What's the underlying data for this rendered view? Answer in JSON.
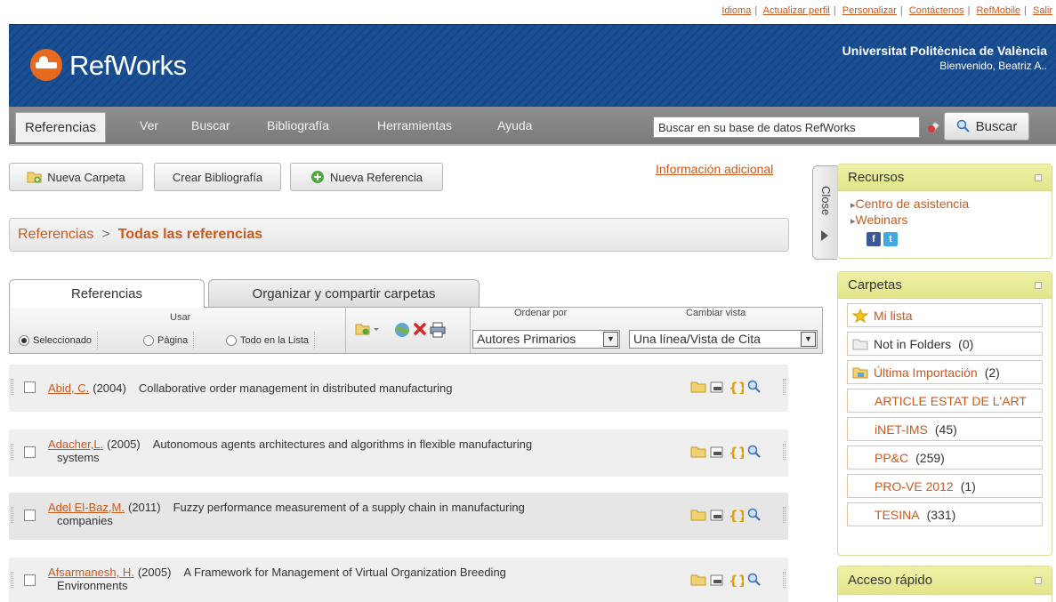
{
  "top_links": [
    "Idioma",
    "Actualizar perfil",
    "Personalizar",
    "Contáctenos",
    "RefMobile",
    "Salir"
  ],
  "header": {
    "logo_text": "RefWorks",
    "institution": "Universitat Politècnica de València",
    "welcome": "Bienvenido, Beatriz A.."
  },
  "nav": {
    "tabs": [
      "Referencias",
      "Ver",
      "Buscar",
      "Bibliografía",
      "Herramientas",
      "Ayuda"
    ],
    "search_value": "Buscar en su base de datos RefWorks",
    "search_button": "Buscar"
  },
  "actions": {
    "new_folder": "Nueva Carpeta",
    "create_bib": "Crear Bibliografía",
    "new_ref": "Nueva Referencia",
    "info_link": "Información adicional"
  },
  "breadcrumb": {
    "root": "Referencias",
    "separator": ">",
    "current": "Todas las referencias"
  },
  "panel_tabs": [
    "Referencias",
    "Organizar y compartir carpetas"
  ],
  "toolbar": {
    "usar_label": "Usar",
    "radios": [
      {
        "label": "Seleccionado",
        "checked": true
      },
      {
        "label": "Página",
        "checked": false
      },
      {
        "label": "Todo en la Lista",
        "checked": false
      }
    ],
    "sort_label": "Ordenar por",
    "sort_value": "Autores Primarios",
    "view_label": "Cambiar vista",
    "view_value": "Una línea/Vista de Cita"
  },
  "references": [
    {
      "author": "Abid, C.",
      "year": "(2004)",
      "title": "Collaborative order management in distributed manufacturing",
      "title2": ""
    },
    {
      "author": "Adacher,L.",
      "year": "(2005)",
      "title": "Autonomous agents architectures and algorithms in flexible manufacturing",
      "title2": "systems"
    },
    {
      "author": "Adel El-Baz,M.",
      "year": "(2011)",
      "title": "Fuzzy performance measurement of a supply chain in manufacturing",
      "title2": "companies"
    },
    {
      "author": "Afsarmanesh, H.",
      "year": "(2005)",
      "title": "A Framework for Management of Virtual Organization Breeding",
      "title2": "Environments"
    }
  ],
  "close_label": "Close",
  "sidebar": {
    "recursos": {
      "title": "Recursos",
      "links": [
        "Centro de asistencia",
        "Webinars"
      ]
    },
    "carpetas": {
      "title": "Carpetas",
      "items": [
        {
          "label": "Mi lista",
          "count": ""
        },
        {
          "label": "Not in Folders",
          "count": "(0)"
        },
        {
          "label": "Última Importación",
          "count": "(2)"
        },
        {
          "label": "ARTICLE ESTAT DE L'ART",
          "count": ""
        },
        {
          "label": "iNET-IMS",
          "count": "(45)"
        },
        {
          "label": "PP&C",
          "count": "(259)"
        },
        {
          "label": "PRO-VE 2012",
          "count": "(1)"
        },
        {
          "label": "TESINA",
          "count": "(331)"
        }
      ]
    },
    "acceso": {
      "title": "Acceso rápido"
    }
  },
  "colors": {
    "accent": "#c9591c",
    "header_blue": "#1b4f94",
    "panel_green": "#e5e98f"
  }
}
